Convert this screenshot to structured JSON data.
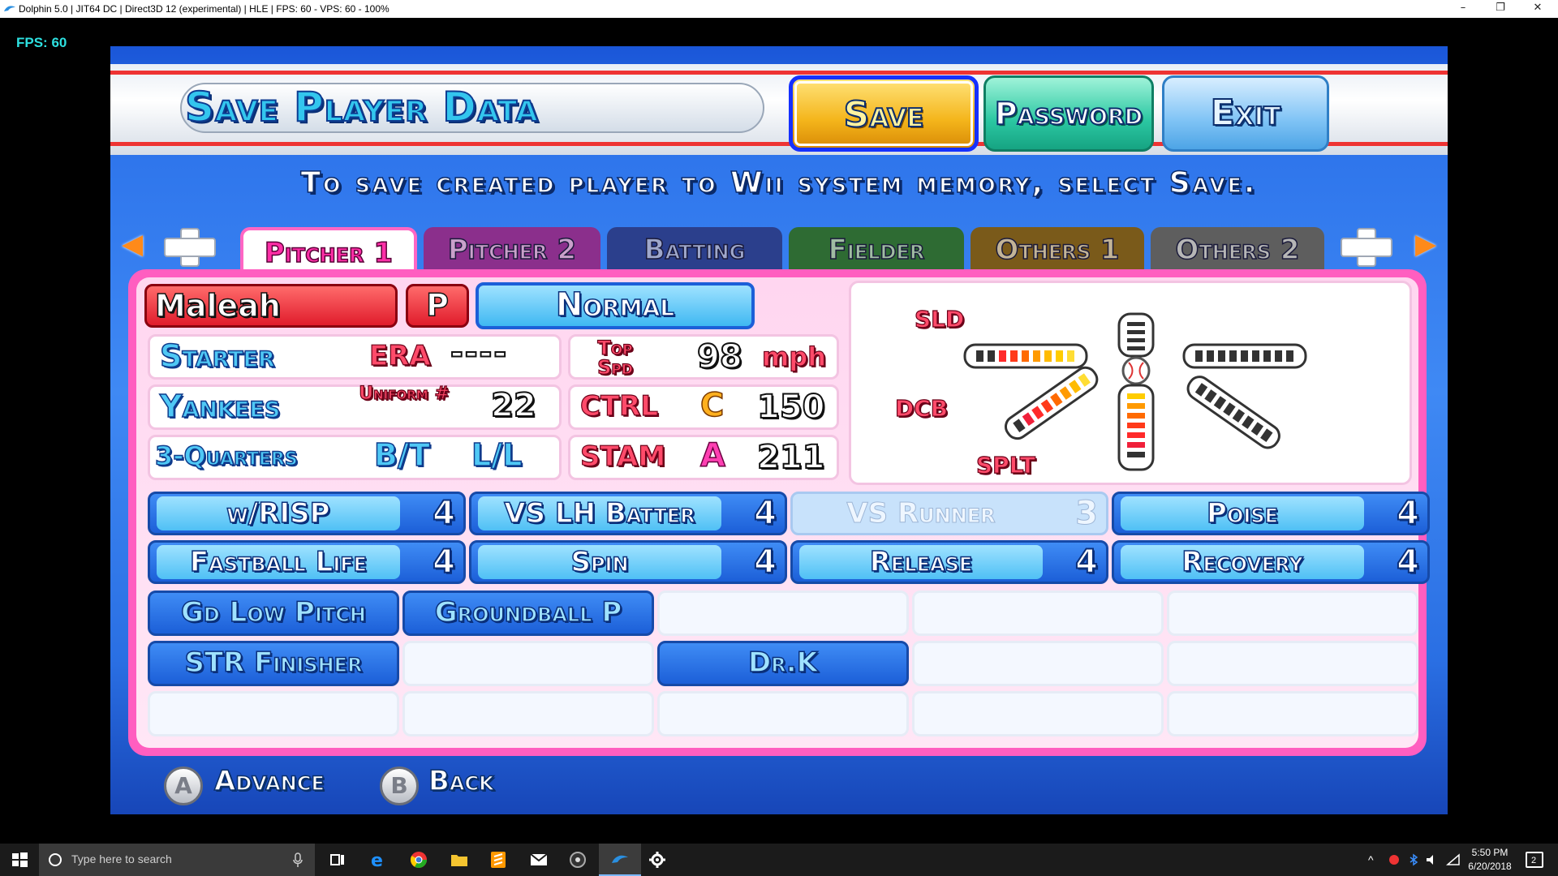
{
  "window": {
    "title": "Dolphin 5.0 | JIT64 DC | Direct3D 12 (experimental) | HLE | FPS: 60 - VPS: 60 - 100%",
    "minimize": "–",
    "maximize": "❐",
    "close": "✕"
  },
  "overlay": {
    "fps": "FPS: 60"
  },
  "game": {
    "title": "Save Player Data",
    "buttons": {
      "save": "Save",
      "password": "Password",
      "exit": "Exit"
    },
    "instruction": "To save created player to Wii system memory, select Save.",
    "tabs": [
      "Pitcher 1",
      "Pitcher 2",
      "Batting",
      "Fielder",
      "Others 1",
      "Others 2"
    ],
    "player": {
      "name": "Maleah",
      "position": "P",
      "condition": "Normal",
      "role": "Starter",
      "era_label": "ERA",
      "era_value": "----",
      "team": "Yankees",
      "uniform_label": "Uniform #",
      "uniform_number": "22",
      "arm_slot": "3-Quarters",
      "bt_label": "B/T",
      "bt_value": "L/L",
      "top_spd_label": "Top Spd",
      "top_spd_value": "98",
      "top_spd_unit": "mph",
      "ctrl_label": "CTRL",
      "ctrl_grade": "C",
      "ctrl_value": "150",
      "stam_label": "STAM",
      "stam_grade": "A",
      "stam_value": "211"
    },
    "pitch_chart": {
      "labels": {
        "sld": "SLD",
        "dcb": "DCB",
        "splt": "SPLT"
      }
    },
    "abilities_row1": [
      {
        "name": "w/RISP",
        "value": "4",
        "dim": false
      },
      {
        "name": "VS LH Batter",
        "value": "4",
        "dim": false
      },
      {
        "name": "VS Runner",
        "value": "3",
        "dim": true
      },
      {
        "name": "Poise",
        "value": "4",
        "dim": false
      }
    ],
    "abilities_row2": [
      {
        "name": "Fastball Life",
        "value": "4"
      },
      {
        "name": "Spin",
        "value": "4"
      },
      {
        "name": "Release",
        "value": "4"
      },
      {
        "name": "Recovery",
        "value": "4"
      }
    ],
    "specials": {
      "gd_low_pitch": "Gd Low Pitch",
      "groundball_p": "Groundball P",
      "str_finisher": "STR Finisher",
      "dr_k": "Dr.K"
    },
    "hints": {
      "a_key": "A",
      "a_label": "Advance",
      "b_key": "B",
      "b_label": "Back"
    }
  },
  "taskbar": {
    "search_placeholder": "Type here to search",
    "time": "5:50 PM",
    "date": "6/20/2018",
    "notification_count": "2"
  }
}
